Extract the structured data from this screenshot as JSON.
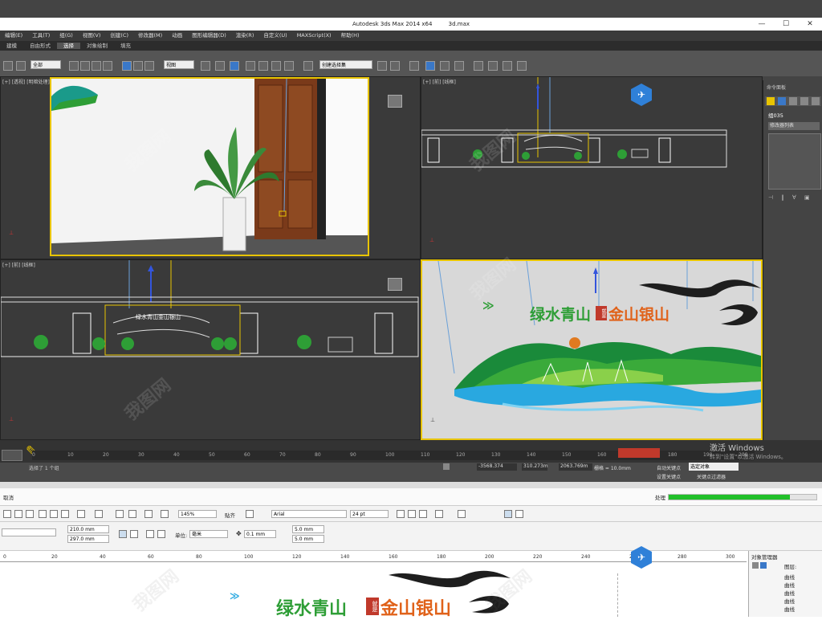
{
  "app": {
    "title": "Autodesk 3ds Max  2014 x64",
    "file": "3d.max"
  },
  "menubar": [
    "编辑(E)",
    "工具(T)",
    "组(G)",
    "视图(V)",
    "创建(C)",
    "修改器(M)",
    "动画",
    "图形编辑器(D)",
    "渲染(R)",
    "自定义(U)",
    "MAXScript(X)",
    "帮助(H)"
  ],
  "ribbon": {
    "tabs": [
      "建模",
      "自由形式",
      "选择",
      "对象绘制",
      "填充"
    ],
    "active_index": 2
  },
  "toolbar": {
    "filter_select": "全部",
    "refcoord_select": "视图",
    "selection_set": "创建选择集"
  },
  "viewports": {
    "top_left_label": "[+] [透视] [明暗处理]",
    "top_right_label": "[+] [前] [线框]",
    "bottom_left_label": "[+] [前] [线框]",
    "bottom_right_label": "",
    "scene_logo": {
      "green_text": "绿水青山",
      "seal_text": "就是",
      "orange_text": "金山银山"
    }
  },
  "command_panel": {
    "header": "命令面板",
    "object_name": "组035",
    "modifier_list": "修改器列表"
  },
  "timeline": {
    "ticks": [
      "0",
      "10",
      "20",
      "30",
      "40",
      "50",
      "60",
      "70",
      "80",
      "90",
      "100",
      "110",
      "120",
      "130",
      "140",
      "150",
      "160",
      "170",
      "180",
      "190",
      "200"
    ]
  },
  "status": {
    "selected": "选择了 1 个组",
    "coord_x": "-3568.374",
    "coord_y": "310.273m",
    "coord_z": "2063.769m",
    "grid": "栅格 = 10.0mm",
    "auto_key": "自动关键点",
    "set_key_select": "选定对象",
    "set_key": "设置关键点",
    "key_filters": "关键点过滤器",
    "activate_windows": "激活 Windows",
    "activate_windows_sub": "转到\"设置\"以激活 Windows。"
  },
  "coreldraw": {
    "cancel": "取消",
    "processing_label": "处理",
    "progress": 0.82,
    "zoom_select": "145%",
    "snap_label": "贴齐",
    "font_select": "Arial",
    "fontsize_select": "24 pt",
    "width": "210.0 mm",
    "height": "297.0 mm",
    "units_label": "单位:",
    "units_select": "毫米",
    "nudge": "0.1 mm",
    "dup_x": "5.0 mm",
    "dup_y": "5.0 mm",
    "ruler_ticks": [
      "0",
      "20",
      "40",
      "60",
      "80",
      "100",
      "120",
      "140",
      "160",
      "180",
      "200",
      "220",
      "240",
      "260",
      "280",
      "300"
    ],
    "object_manager": {
      "title": "对象管理器",
      "layer_label": "图层:",
      "items": [
        "曲线",
        "曲线",
        "曲线",
        "曲线",
        "曲线"
      ]
    },
    "logo": {
      "green_text": "绿水青山",
      "seal_text": "就是",
      "orange_text": "金山银山"
    }
  },
  "watermark": "我图网",
  "colors": {
    "max_bg": "#444444",
    "viewport_active": "#e8c400",
    "logo_green": "#2e9e36",
    "logo_orange": "#e0621a",
    "seal_red": "#c0392b",
    "progress_green": "#22c02a"
  }
}
